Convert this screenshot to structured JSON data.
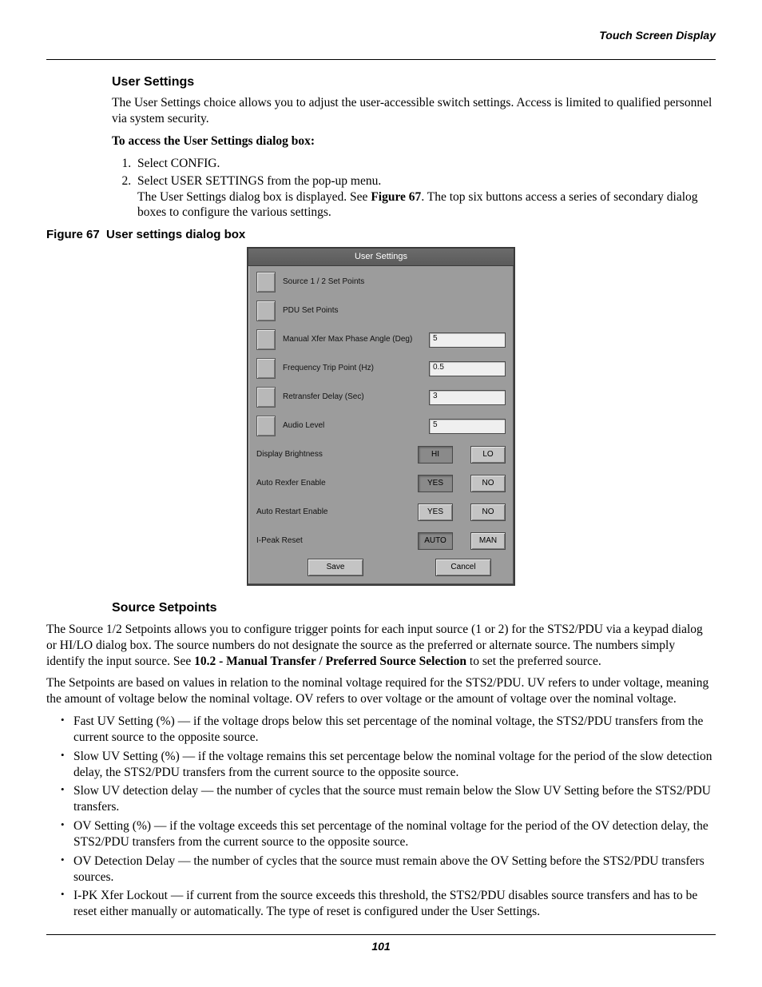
{
  "runningHead": "Touch Screen Display",
  "pageNumber": "101",
  "userSettings": {
    "heading": "User Settings",
    "intro": "The User Settings choice allows you to adjust the user-accessible switch settings. Access is limited to qualified personnel via system security.",
    "accessHead": "To access the User Settings dialog box:",
    "steps": {
      "s1": "Select CONFIG.",
      "s2a": "Select USER SETTINGS from the pop-up menu.",
      "s2b_pre": "The User Settings dialog box is displayed. See ",
      "s2b_bold": "Figure 67",
      "s2b_post": ". The top six buttons access a series of secondary dialog boxes to configure the various settings."
    }
  },
  "figure": {
    "caption_prefix": "Figure 67",
    "caption_rest": "User settings dialog box"
  },
  "dlg": {
    "title": "User Settings",
    "rows": {
      "r1": "Source 1 / 2 Set Points",
      "r2": "PDU Set Points",
      "r3": "Manual Xfer Max Phase Angle (Deg)",
      "r3v": "5",
      "r4": "Frequency Trip Point (Hz)",
      "r4v": "0.5",
      "r5": "Retransfer Delay (Sec)",
      "r5v": "3",
      "r6": "Audio Level",
      "r6v": "5",
      "r7": "Display Brightness",
      "r7a": "HI",
      "r7b": "LO",
      "r8": "Auto Rexfer Enable",
      "r8a": "YES",
      "r8b": "NO",
      "r9": "Auto Restart Enable",
      "r9a": "YES",
      "r9b": "NO",
      "r10": "I-Peak Reset",
      "r10a": "AUTO",
      "r10b": "MAN"
    },
    "save": "Save",
    "cancel": "Cancel"
  },
  "sourceSetpoints": {
    "heading": "Source Setpoints",
    "p1_pre": "The Source 1/2 Setpoints allows you to configure trigger points for each input source (1 or 2) for the STS2/PDU via a keypad dialog or HI/LO dialog box. The source numbers do not designate the source as the preferred or alternate source. The numbers simply identify the input source. See ",
    "p1_bold": "10.2 - Manual Transfer / Preferred Source Selection",
    "p1_post": " to set the preferred source.",
    "p2": "The Setpoints are based on values in relation to the nominal voltage required for the STS2/PDU. UV refers to under voltage, meaning the amount of voltage below the nominal voltage. OV refers to over voltage or the amount of voltage over the nominal voltage.",
    "bullets": {
      "b1": "Fast UV Setting (%) — if the voltage drops below this set percentage of the nominal voltage, the STS2/PDU transfers from the current source to the opposite source.",
      "b2": "Slow UV Setting (%) — if the voltage remains this set percentage below the nominal voltage for the period of the slow detection delay, the STS2/PDU transfers from the current source to the opposite source.",
      "b3": "Slow UV detection delay — the number of cycles that the source must remain below the Slow UV Setting before the STS2/PDU transfers.",
      "b4": "OV Setting (%) — if the voltage exceeds this set percentage of the nominal voltage for the period of the OV detection delay, the STS2/PDU transfers from the current source to the opposite source.",
      "b5": "OV Detection Delay — the number of cycles that the source must remain above the OV Setting before the STS2/PDU transfers sources.",
      "b6": "I-PK Xfer Lockout — if current from the source exceeds this threshold, the STS2/PDU disables source transfers and has to be reset either manually or automatically. The type of reset is configured under the User Settings."
    }
  }
}
